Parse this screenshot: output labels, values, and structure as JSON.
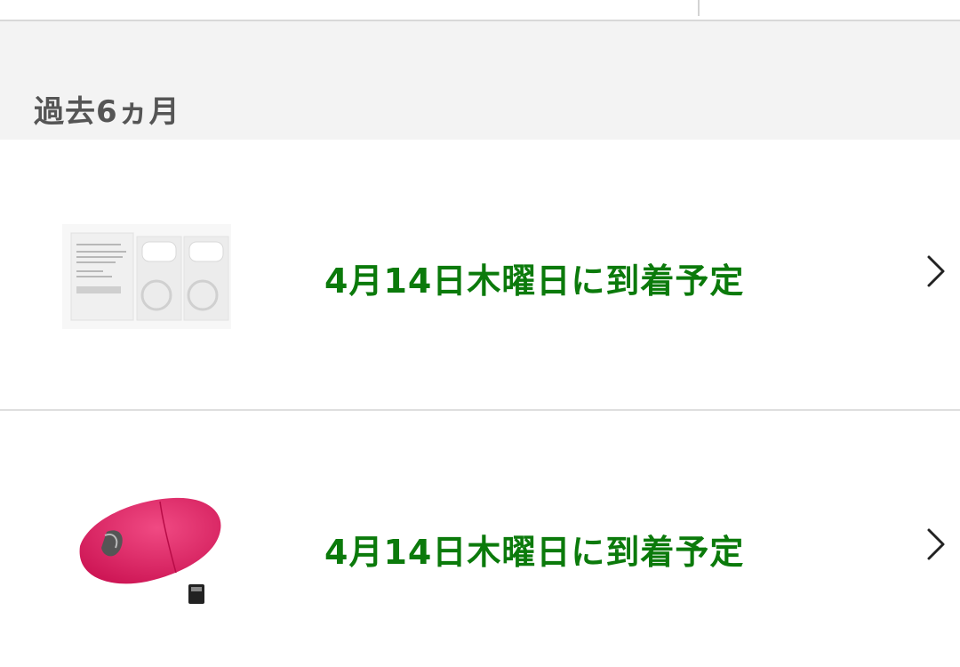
{
  "section": {
    "title": "過去6ヵ月"
  },
  "orders": [
    {
      "status": "4月14日木曜日に到着予定",
      "image": "mouse-skates-product-image",
      "arrow": "chevron-right-icon"
    },
    {
      "status": "4月14日木曜日に到着予定",
      "image": "pink-wireless-mouse-product-image",
      "arrow": "chevron-right-icon"
    }
  ],
  "colors": {
    "status_green": "#0b7a0b",
    "header_bg": "#f3f3f3",
    "mouse_pink": "#e01a5f"
  }
}
